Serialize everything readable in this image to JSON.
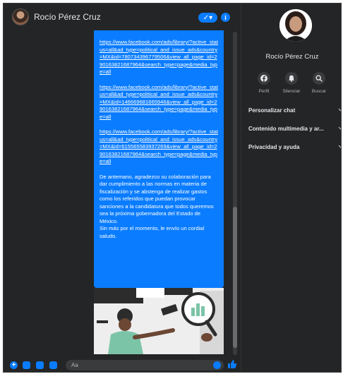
{
  "chat": {
    "contact_name": "Rocío Pérez Cruz",
    "header_pill": "✓▾",
    "header_info": "i",
    "links": [
      "https://www.facebook.com/ads/library/?active_status=all&ad_type=political_and_issue_ads&country=MX&id=780734396779506&view_all_page_id=290163821687964&search_type=page&media_type=all",
      "https://www.facebook.com/ads/library/?active_status=all&ad_type=political_and_issue_ads&country=MX&id=146669681665946&view_all_page_id=290163821687964&search_type=page&media_type=all",
      "https://www.facebook.com/ads/library/?active_status=all&ad_type=political_and_issue_ads&country=MX&id=615565583937269&view_all_page_id=290163821687964&search_type=page&media_type=all"
    ],
    "message_body": "De antemano, agradezco su colaboración para dar cumplimiento a las normas en materia de fiscalización y se abstenga de realizar gastos como los referidos que puedan provocar sanciones a la candidatura que todos queremos sea la próxima gobernadora del Estado de México.",
    "message_closing": "Sin más por el momento, le envío un cordial saludo.",
    "input_placeholder": "Aa",
    "composer_plus": "+"
  },
  "side_panel": {
    "name": "Rocío Pérez Cruz",
    "actions": [
      {
        "label": "Perfil",
        "icon": "facebook-icon"
      },
      {
        "label": "Silenciar",
        "icon": "bell-icon"
      },
      {
        "label": "Buscar",
        "icon": "search-icon"
      }
    ],
    "sections": [
      {
        "label": "Personalizar chat"
      },
      {
        "label": "Contenido multimedia y ar..."
      },
      {
        "label": "Privacidad y ayuda"
      }
    ]
  },
  "colors": {
    "accent": "#0a7cff",
    "background": "#242526",
    "text": "#e4e6eb",
    "muted": "#b0b3b8"
  }
}
